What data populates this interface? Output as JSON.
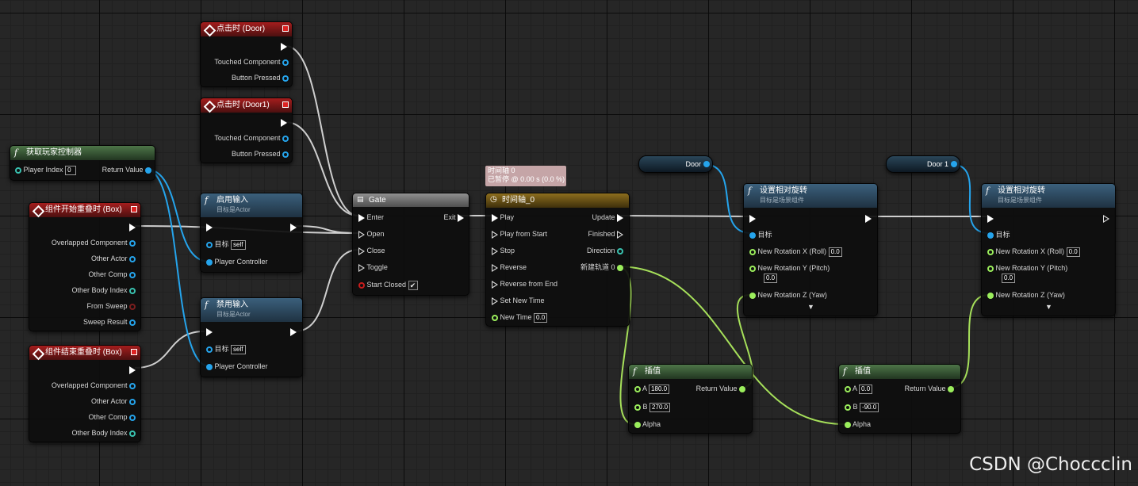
{
  "nodes": {
    "click_door": {
      "title": "点击时 (Door)",
      "pins": [
        "Touched Component",
        "Button Pressed"
      ]
    },
    "click_door1": {
      "title": "点击时 (Door1)",
      "pins": [
        "Touched Component",
        "Button Pressed"
      ]
    },
    "get_player_controller": {
      "title": "获取玩家控制器",
      "in_label": "Player Index",
      "in_value": "0",
      "out_label": "Return Value"
    },
    "overlap_begin": {
      "title": "组件开始重叠时 (Box)",
      "pins": [
        "Overlapped Component",
        "Other Actor",
        "Other Comp",
        "Other Body Index",
        "From Sweep",
        "Sweep Result"
      ]
    },
    "overlap_end": {
      "title": "组件结束重叠时 (Box)",
      "pins": [
        "Overlapped Component",
        "Other Actor",
        "Other Comp",
        "Other Body Index"
      ]
    },
    "enable_input": {
      "title": "启用输入",
      "subtitle": "目标是Actor",
      "target_label": "目标",
      "target_value": "self",
      "controller_label": "Player Controller"
    },
    "disable_input": {
      "title": "禁用输入",
      "subtitle": "目标是Actor",
      "target_label": "目标",
      "target_value": "self",
      "controller_label": "Player Controller"
    },
    "gate": {
      "title": "Gate",
      "inputs": [
        "Enter",
        "Open",
        "Close",
        "Toggle",
        "Start Closed"
      ],
      "exit_label": "Exit",
      "start_closed_checked": "✔"
    },
    "timeline": {
      "title": "时间轴_0",
      "comment_line1": "时间轴 0",
      "comment_line2": "已暂停 @ 0.00 s (0.0 %)",
      "inputs": [
        "Play",
        "Play from Start",
        "Stop",
        "Reverse",
        "Reverse from End",
        "Set New Time",
        "New Time"
      ],
      "new_time_value": "0.0",
      "outputs": [
        "Update",
        "Finished",
        "Direction",
        "新建轨道 0"
      ]
    },
    "door_var": {
      "label": "Door"
    },
    "door1_var": {
      "label": "Door 1"
    },
    "set_rot_1": {
      "title": "设置相对旋转",
      "subtitle": "目标是场景组件",
      "target_label": "目标",
      "roll_label": "New Rotation X (Roll)",
      "roll_value": "0.0",
      "pitch_label": "New Rotation Y (Pitch)",
      "pitch_value": "0.0",
      "yaw_label": "New Rotation Z (Yaw)"
    },
    "set_rot_2": {
      "title": "设置相对旋转",
      "subtitle": "目标是场景组件",
      "target_label": "目标",
      "roll_label": "New Rotation X (Roll)",
      "roll_value": "0.0",
      "pitch_label": "New Rotation Y (Pitch)",
      "pitch_value": "0.0",
      "yaw_label": "New Rotation Z (Yaw)"
    },
    "lerp_1": {
      "title": "插值",
      "a_label": "A",
      "a_value": "180.0",
      "b_label": "B",
      "b_value": "270.0",
      "alpha_label": "Alpha",
      "out_label": "Return Value"
    },
    "lerp_2": {
      "title": "插值",
      "a_label": "A",
      "a_value": "0.0",
      "b_label": "B",
      "b_value": "-90.0",
      "alpha_label": "Alpha",
      "out_label": "Return Value"
    }
  },
  "watermark": "CSDN @Choccclin",
  "colors": {
    "exec": "#ffffff",
    "object": "#25a4ec",
    "float": "#9bee5c",
    "event_header": "#a51d1d",
    "function_header": "#3b607c"
  }
}
